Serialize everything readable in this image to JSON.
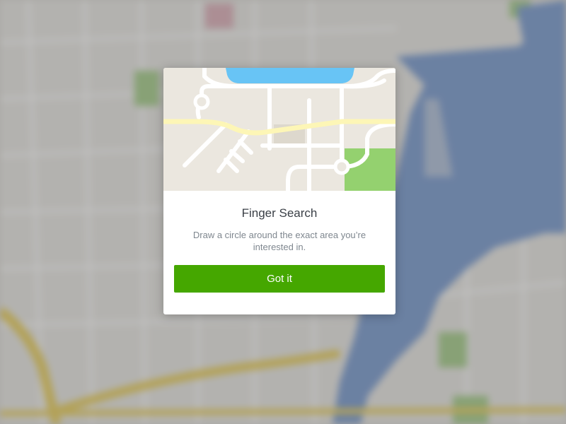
{
  "dialog": {
    "title": "Finger Search",
    "description": "Draw a circle around the exact area you’re interested in.",
    "button_label": "Got it"
  },
  "colors": {
    "primary_button": "#45a700",
    "map_water": "#6a8fc9",
    "map_highway": "#e6c84a",
    "map_park": "#9bc77c",
    "illustration_land": "#ebe7df",
    "illustration_water": "#68c4f5",
    "illustration_park": "#94d16f",
    "illustration_main_road": "#fdf6b6"
  },
  "icons": {
    "illustration": "map-illustration"
  }
}
